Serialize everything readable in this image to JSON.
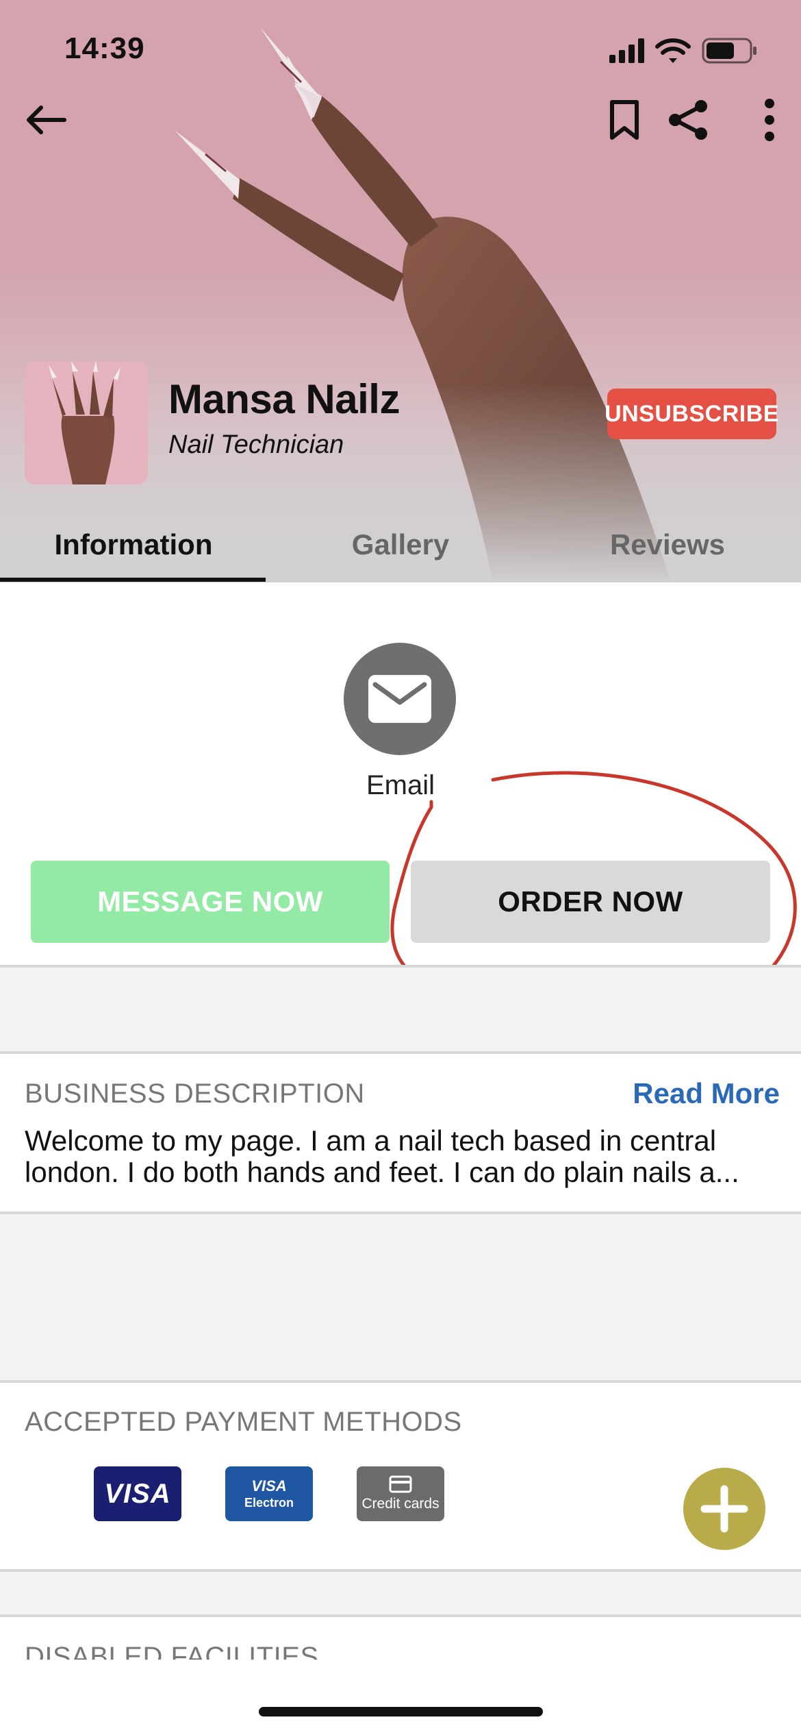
{
  "status_bar": {
    "time": "14:39"
  },
  "header": {
    "business_name": "Mansa Nailz",
    "business_role": "Nail Technician",
    "unsubscribe_label": "UNSUBSCRIBE"
  },
  "tabs": [
    {
      "label": "Information",
      "active": true
    },
    {
      "label": "Gallery",
      "active": false
    },
    {
      "label": "Reviews",
      "active": false
    }
  ],
  "contact": {
    "email_label": "Email",
    "message_button": "MESSAGE NOW",
    "order_button": "ORDER NOW"
  },
  "business_description": {
    "title": "BUSINESS DESCRIPTION",
    "read_more": "Read More",
    "lines": [
      "Welcome to my page. I am a nail tech based in central",
      "london. I do both hands and feet. I can do plain nails a..."
    ]
  },
  "payment_methods": {
    "title": "ACCEPTED PAYMENT METHODS",
    "cards": [
      {
        "name": "visa-card",
        "text": "VISA"
      },
      {
        "name": "visa-electron-card",
        "text": "VISA",
        "subtext": "Electron"
      },
      {
        "name": "credit-cards",
        "text": "Credit cards"
      }
    ]
  },
  "disabled_facilities": {
    "title": "DISABLED FACILITIES"
  },
  "colors": {
    "unsubscribe": "#e55044",
    "message_button": "#92eaa4",
    "order_button": "#d9d9d9",
    "read_more": "#2a69b8",
    "fab": "#b9ab4a",
    "annotation": "#c8372c"
  },
  "icons": [
    "back-arrow-icon",
    "bookmark-icon",
    "share-icon",
    "more-vertical-icon",
    "email-icon",
    "plus-icon",
    "signal-icon",
    "wifi-icon",
    "battery-icon"
  ]
}
